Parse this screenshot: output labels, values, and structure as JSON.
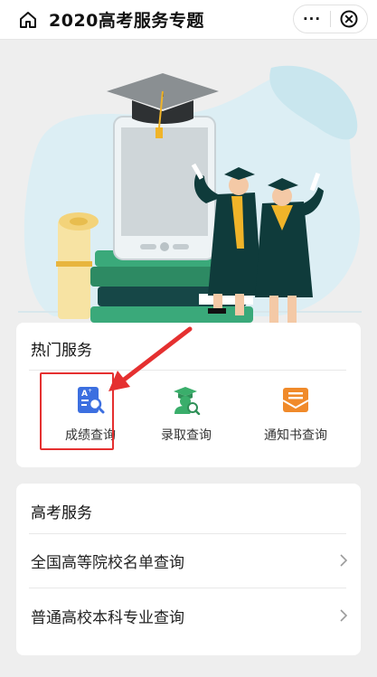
{
  "header": {
    "title": "2020高考服务专题",
    "more_label": "···"
  },
  "hot_services": {
    "title": "热门服务",
    "items": [
      {
        "label": "成绩查询",
        "icon": "score-search-icon",
        "color": "#3c6fe0"
      },
      {
        "label": "录取查询",
        "icon": "admission-search-icon",
        "color": "#3aae6b"
      },
      {
        "label": "通知书查询",
        "icon": "envelope-icon",
        "color": "#f08a2a"
      }
    ]
  },
  "gaokao_services": {
    "title": "高考服务",
    "items": [
      {
        "label": "全国高等院校名单查询"
      },
      {
        "label": "普通高校本科专业查询"
      }
    ]
  },
  "colors": {
    "highlight": "#e53030",
    "banner_bg": "#dceef4",
    "book_green": "#3aa97a",
    "gown": "#0f3b3b",
    "stole": "#f0b429"
  }
}
